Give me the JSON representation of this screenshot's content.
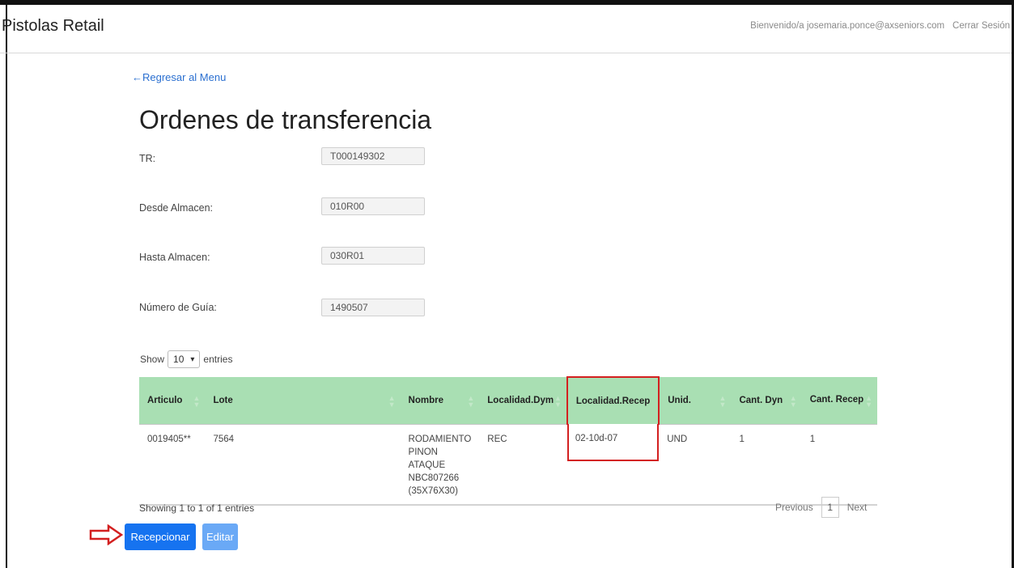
{
  "navbar": {
    "brand": "Pistolas Retail",
    "welcome": "Bienvenido/a josemaria.ponce@axseniors.com",
    "logout": "Cerrar Sesión"
  },
  "back_link": "←Regresar al Menu",
  "page_title": "Ordenes de transferencia",
  "form": {
    "tr": {
      "label": "TR:",
      "value": "T000149302"
    },
    "desde": {
      "label": "Desde Almacen:",
      "value": "010R00"
    },
    "hasta": {
      "label": "Hasta Almacen:",
      "value": "030R01"
    },
    "guia": {
      "label": "Número de Guía:",
      "value": "1490507"
    }
  },
  "entries": {
    "show": "Show",
    "selected": "10",
    "suffix": "entries"
  },
  "table": {
    "headers": [
      "Articulo",
      "Lote",
      "Nombre",
      "Localidad.Dym",
      "Localidad.Recep",
      "Unid.",
      "Cant. Dyn",
      "Cant. Recep"
    ],
    "rows": [
      {
        "articulo": "0019405**",
        "lote": "7564",
        "nombre": [
          "RODAMIENTO",
          "PINON ATAQUE",
          "NBC807266",
          "(35X76X30)"
        ],
        "localidad_dym": "REC",
        "localidad_recep": "02-10d-07",
        "unid": "UND",
        "cant_dyn": "1",
        "cant_recep": "1"
      }
    ]
  },
  "info": "Showing 1 to 1 of 1 entries",
  "pagination": {
    "previous": "Previous",
    "page": "1",
    "next": "Next"
  },
  "buttons": {
    "recepcionar": "Recepcionar",
    "editar": "Editar"
  },
  "colors": {
    "header_bg": "#a9dfb3",
    "primary": "#1673f0",
    "highlight": "#d32020"
  }
}
